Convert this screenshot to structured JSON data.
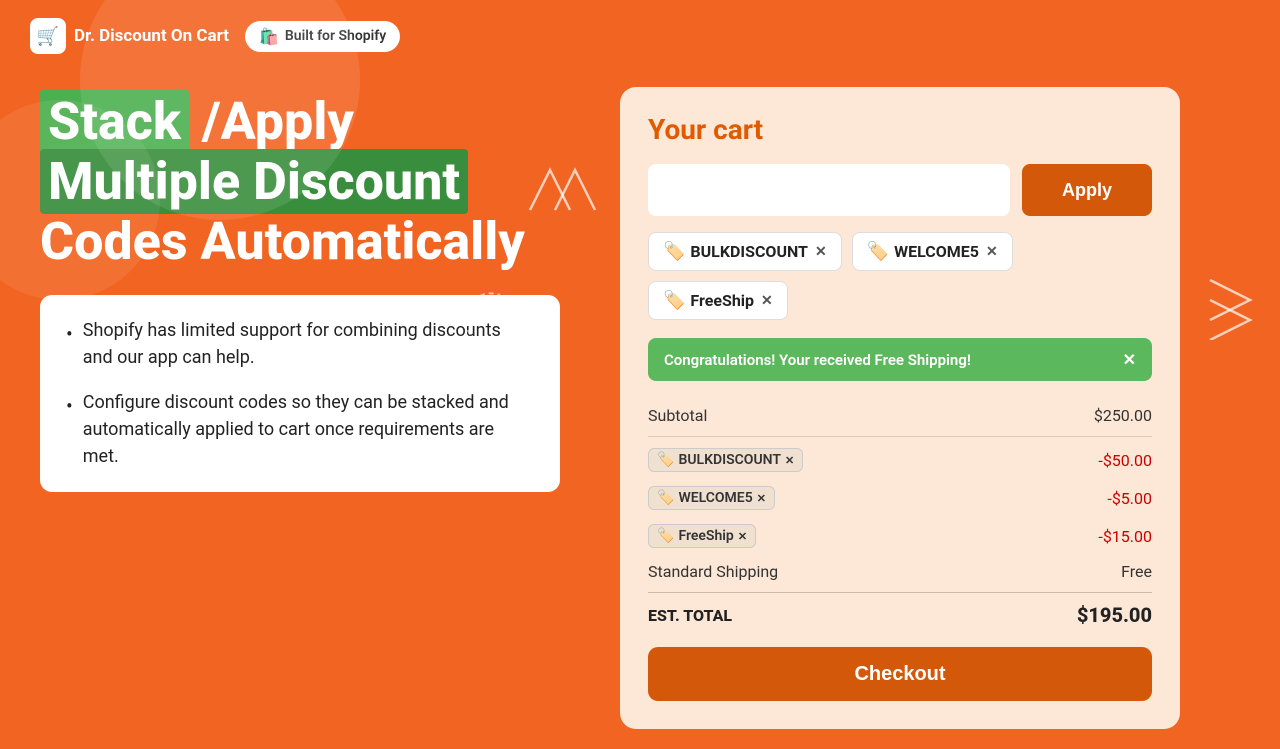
{
  "brand": {
    "name": "Dr. Discount On Cart",
    "icon": "🛒",
    "shopify_badge": "Built for Shopify"
  },
  "headline": {
    "part1": "Stack ",
    "slash": "/",
    "part2": "Apply",
    "line2": "Multiple Discount",
    "line3": "Codes Automatically"
  },
  "bullets": [
    "Shopify has limited support for combining discounts and our app can help.",
    "Configure discount codes so they can be stacked and automatically applied to cart once requirements are met."
  ],
  "cart": {
    "title": "Your cart",
    "input_placeholder": "",
    "apply_label": "Apply",
    "tags": [
      {
        "code": "BULKDISCOUNT"
      },
      {
        "code": "WELCOME5"
      },
      {
        "code": "FreeShip"
      }
    ],
    "success_message": "Congratulations! Your received Free Shipping!",
    "summary": {
      "subtotal_label": "Subtotal",
      "subtotal_value": "$250.00",
      "discount_rows": [
        {
          "code": "BULKDISCOUNT",
          "amount": "-$50.00"
        },
        {
          "code": "WELCOME5",
          "amount": "-$5.00"
        },
        {
          "code": "FreeShip",
          "amount": "-$15.00"
        }
      ],
      "shipping_label": "Standard Shipping",
      "shipping_value": "Free",
      "total_label": "EST. TOTAL",
      "total_value": "$195.00"
    },
    "checkout_label": "Checkout"
  },
  "colors": {
    "orange": "#F26422",
    "dark_orange": "#D4580A",
    "green": "#4CAF50",
    "dark_green": "#388E3C",
    "cart_bg": "#FDE8D8",
    "success_green": "#5CB85C"
  }
}
